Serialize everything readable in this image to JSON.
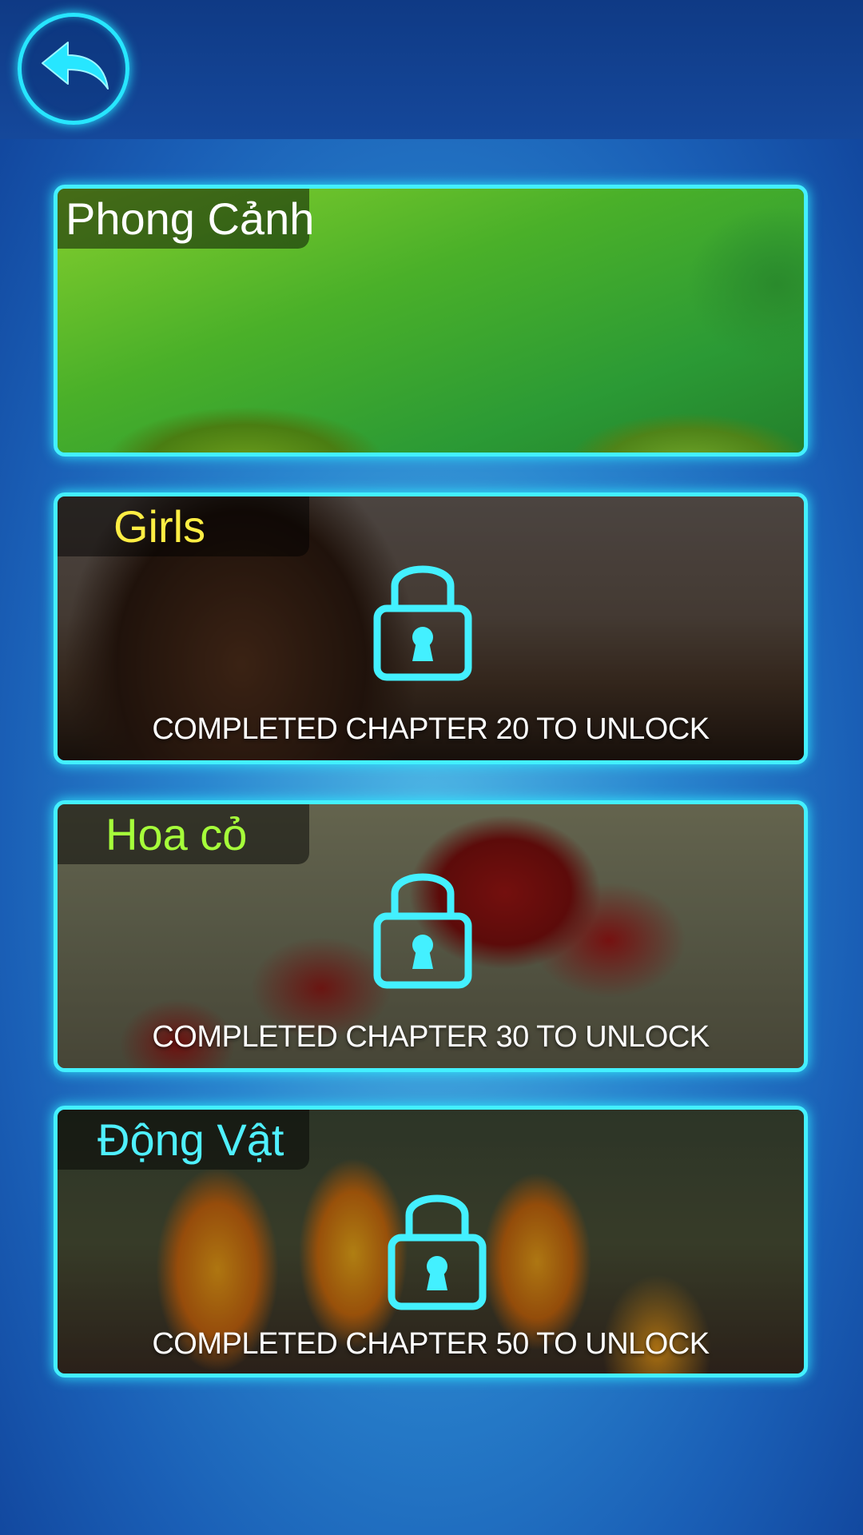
{
  "header": {
    "back_icon": "back-arrow-icon"
  },
  "colors": {
    "neon": "#43f0ff",
    "title_landscape": "#ffffff",
    "title_girls": "#ffee44",
    "title_flowers": "#a6ff3a",
    "title_animals": "#4ff0ff"
  },
  "categories": [
    {
      "title": "Phong Cảnh",
      "locked": false,
      "unlock_text": ""
    },
    {
      "title": "Girls",
      "locked": true,
      "lock_icon": "padlock-icon",
      "unlock_text": "COMPLETED CHAPTER 20 TO UNLOCK"
    },
    {
      "title": "Hoa cỏ",
      "locked": true,
      "lock_icon": "padlock-icon",
      "unlock_text": "COMPLETED CHAPTER 30 TO UNLOCK"
    },
    {
      "title": "Động Vật",
      "locked": true,
      "lock_icon": "padlock-icon",
      "unlock_text": "COMPLETED CHAPTER 50 TO UNLOCK"
    }
  ]
}
